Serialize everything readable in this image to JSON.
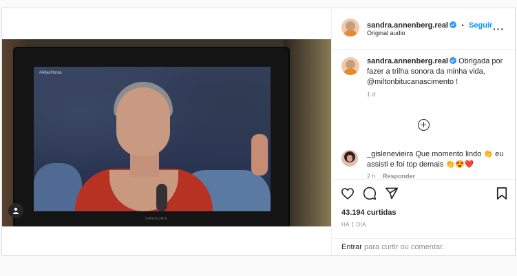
{
  "post": {
    "author": "sandra.annenberg.real",
    "follow_label": "Seguir",
    "separator": "•",
    "audio": "Original audio",
    "more_icon": "more-horizontal-icon"
  },
  "media": {
    "tv_tag": "#AltasHoras",
    "tv_brand": "SAMSUNG",
    "user_tag_icon": "user-icon"
  },
  "caption": {
    "author": "sandra.annenberg.real",
    "text": "Obrigada por fazer a trilha sonora da minha vida, @miltonbitucanascimento !",
    "time": "1 d"
  },
  "comments": [
    {
      "author": "_gislenevieira",
      "text": "Que momento lindo 👏 eu assisti e foi top demais 👏😍❤️",
      "time": "2 h",
      "reply_label": "Responder"
    }
  ],
  "actions": {
    "likes": "43.194 curtidas",
    "date": "HÁ 1 DIA"
  },
  "footer": {
    "login_link": "Entrar",
    "login_rest": " para curtir ou comentar."
  },
  "colors": {
    "accent": "#0095f6",
    "verified": "#3897f0",
    "text": "#262626",
    "muted": "#8e8e8e"
  }
}
